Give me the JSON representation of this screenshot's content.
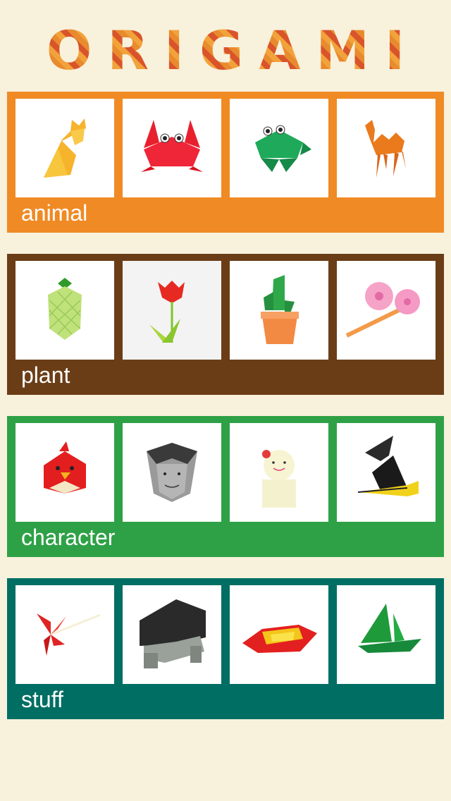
{
  "app": {
    "title": "ORIGAMI"
  },
  "colors": {
    "background": "#f8f1dc",
    "animal": "#f08a24",
    "plant": "#6b3d17",
    "character": "#2ea146",
    "stuff": "#006e63"
  },
  "categories": [
    {
      "label": "animal",
      "items": [
        "cat-icon",
        "crab-icon",
        "frog-icon",
        "camel-icon"
      ]
    },
    {
      "label": "plant",
      "items": [
        "pineapple-icon",
        "tulip-icon",
        "cactus-icon",
        "morning-glory-icon"
      ]
    },
    {
      "label": "character",
      "items": [
        "angry-bird-icon",
        "dracula-icon",
        "doll-icon",
        "witch-icon"
      ]
    },
    {
      "label": "stuff",
      "items": [
        "pinwheel-icon",
        "chair-icon",
        "boat-icon",
        "sailboat-icon"
      ]
    }
  ]
}
